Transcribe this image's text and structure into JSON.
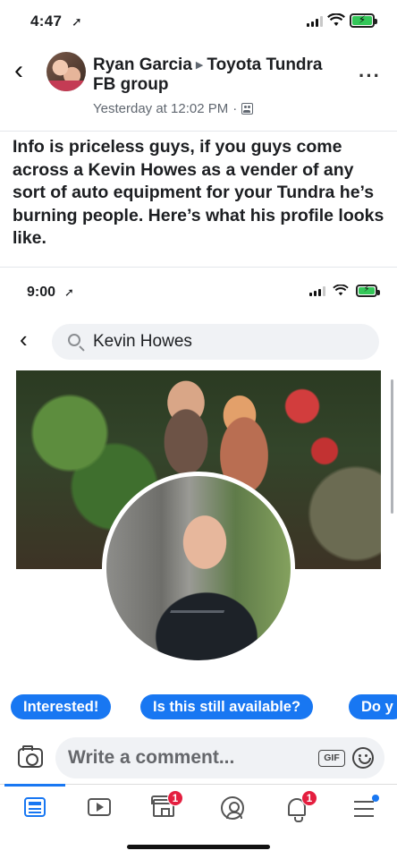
{
  "status_bar": {
    "time": "4:47",
    "location_glyph": "➚"
  },
  "post": {
    "author": "Ryan Garcia",
    "group": "Toyota Tundra FB group",
    "timestamp": "Yesterday at 12:02 PM",
    "separator": "·",
    "body": "Info is priceless guys, if you guys come across a Kevin Howes as a vender of any sort of auto equipment for your Tundra he’s burning people. Here’s what his profile looks like."
  },
  "embedded_screenshot": {
    "status_time": "9:00",
    "location_glyph": "➚",
    "search_value": "Kevin Howes"
  },
  "quick_replies": [
    "Interested!",
    "Is this still available?",
    "Do y"
  ],
  "composer": {
    "placeholder": "Write a comment...",
    "gif_label": "GIF"
  },
  "tab_bar": {
    "tabs": [
      {
        "name": "feed",
        "icon": "news-feed-icon",
        "active": true
      },
      {
        "name": "watch",
        "icon": "watch-icon"
      },
      {
        "name": "marketplace",
        "icon": "marketplace-icon",
        "badge": "1"
      },
      {
        "name": "profile",
        "icon": "profile-icon"
      },
      {
        "name": "notifications",
        "icon": "bell-icon",
        "badge": "1"
      },
      {
        "name": "menu",
        "icon": "menu-icon"
      }
    ]
  },
  "colors": {
    "accent": "#1877f2",
    "badge": "#e41e3f",
    "battery": "#34c759"
  }
}
